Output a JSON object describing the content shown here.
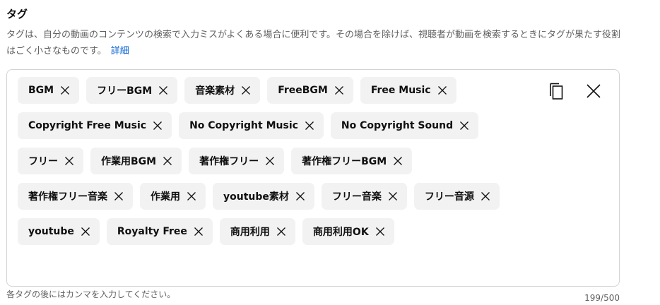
{
  "title": "タグ",
  "description": {
    "text": "タグは、自分の動画のコンテンツの検索で入力ミスがよくある場合に便利です。その場合を除けば、視聴者が動画を検索するときにタグが果たす役割はごく小さなものです。",
    "link": "詳細"
  },
  "tags": [
    "BGM",
    "フリーBGM",
    "音楽素材",
    "FreeBGM",
    "Free Music",
    "Copyright Free Music",
    "No Copyright Music",
    "No Copyright Sound",
    "フリー",
    "作業用BGM",
    "著作権フリー",
    "著作権フリーBGM",
    "著作権フリー音楽",
    "作業用",
    "youtube素材",
    "フリー音楽",
    "フリー音源",
    "youtube",
    "Royalty Free",
    "商用利用",
    "商用利用OK"
  ],
  "toolbar": {
    "copy_icon": "copy-icon",
    "clear_icon": "clear-all-icon"
  },
  "hint": "各タグの後にはカンマを入力してください。",
  "counter": "199/500"
}
